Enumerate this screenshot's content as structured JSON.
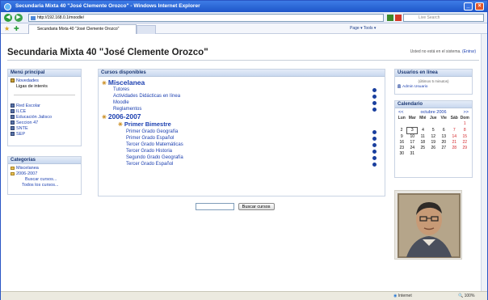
{
  "browser": {
    "title": "Secundaria Mixta 40 \"José Clemente Orozco\" - Windows Internet Explorer",
    "url": "http://192.168.0.1/moodle/",
    "tab_label": "Secundaria Mixta 40 \"José Clemente Orozco\"",
    "search_placeholder": "Live Search",
    "tools": "Page ▾  Tools ▾",
    "status_zone": "Internet",
    "zoom": "100%"
  },
  "site": {
    "title": "Secundaria Mixta 40 \"José Clemente Orozco\"",
    "login_text": "Usted no está en el sistema.",
    "login_link": "(Entrar)"
  },
  "main_menu": {
    "heading": "Menú principal",
    "news": "Novedades",
    "links_of_interest": "Ligas de interés",
    "links": [
      "Red Escolar",
      "ILCE",
      "Educación Jalisco",
      "Seccion 47",
      "SNTE",
      "SEP"
    ]
  },
  "categories": {
    "heading": "Categorías",
    "items": [
      "Miscelanea",
      "2006-2007"
    ],
    "search_courses": "Buscar cursos...",
    "all_courses": "Todos los cursos..."
  },
  "courses": {
    "heading": "Cursos disponibles",
    "cat1": "Miscelanea",
    "cat1_items": [
      "Tutores",
      "Actividades Didácticas en línea",
      "Moodle",
      "Reglamentos"
    ],
    "cat2": "2006-2007",
    "subcat": "Primer Bimestre",
    "subcat_items": [
      "Primer Grado Geografía",
      "Primer Grado Español",
      "Tercer Grado Matemáticas",
      "Tercer Grado Historia",
      "Segundo Grado Geografía",
      "Tercer Grado Español"
    ],
    "search_button": "Buscar cursos"
  },
  "online": {
    "heading": "Usuarios en línea",
    "subtitle": "(últimos 5 minutos)",
    "user": "Admin Usuario"
  },
  "calendar": {
    "heading": "Calendario",
    "prev": "<<",
    "month": "octubre 2006",
    "next": ">>",
    "days": [
      "Lun",
      "Mar",
      "Mié",
      "Jue",
      "Vie",
      "Sáb",
      "Dom"
    ],
    "weeks": [
      [
        "",
        "",
        "",
        "",
        "",
        "",
        "1"
      ],
      [
        "2",
        "3",
        "4",
        "5",
        "6",
        "7",
        "8"
      ],
      [
        "9",
        "10",
        "11",
        "12",
        "13",
        "14",
        "15"
      ],
      [
        "16",
        "17",
        "18",
        "19",
        "20",
        "21",
        "22"
      ],
      [
        "23",
        "24",
        "25",
        "26",
        "27",
        "28",
        "29"
      ],
      [
        "30",
        "31",
        "",
        "",
        "",
        "",
        ""
      ]
    ],
    "today": "3",
    "weekend_color": "#d4262b"
  },
  "colors": {
    "link": "#1b3fb0",
    "block_header": "#c9d8ef",
    "titlebar": "#1e56c9"
  }
}
